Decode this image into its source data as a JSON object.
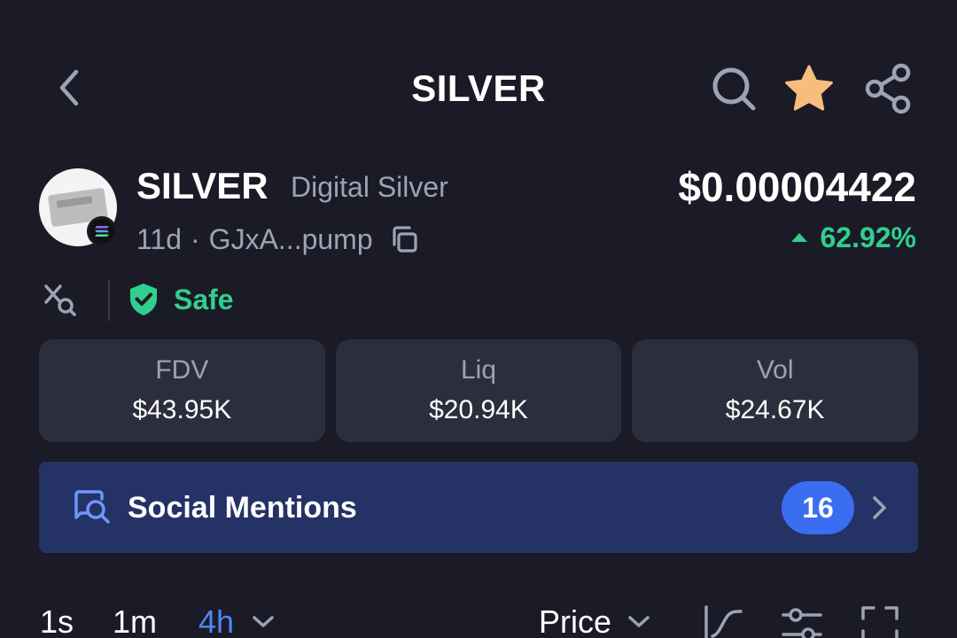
{
  "header": {
    "title": "SILVER"
  },
  "token": {
    "symbol": "SILVER",
    "name": "Digital Silver",
    "age": "11d",
    "address": "GJxA...pump",
    "meta_separator": "·",
    "price": "$0.00004422",
    "change": "62.92%",
    "change_direction": "up",
    "favorited": true
  },
  "safety": {
    "label": "Safe"
  },
  "stats": [
    {
      "label": "FDV",
      "value": "$43.95K"
    },
    {
      "label": "Liq",
      "value": "$20.94K"
    },
    {
      "label": "Vol",
      "value": "$24.67K"
    }
  ],
  "social": {
    "label": "Social Mentions",
    "count": "16"
  },
  "toolbar": {
    "timeframes": [
      "1s",
      "1m",
      "4h"
    ],
    "selected_timeframe": "4h",
    "price_label": "Price"
  },
  "icons": {
    "back": "chevron-left-icon",
    "search": "search-icon",
    "favorite": "star-icon",
    "share": "share-icon",
    "copy": "copy-icon",
    "x_search": "x-search-icon",
    "safe": "shield-check-icon",
    "social": "chat-search-icon",
    "chart_type": "line-chart-icon",
    "settings": "sliders-icon",
    "fullscreen": "fullscreen-icon"
  },
  "colors": {
    "background": "#1a1b26",
    "card": "#2c2e3d",
    "social_bg": "#253265",
    "positive": "#2fcf8e",
    "accent_blue": "#3a6df0",
    "selected_timeframe": "#4f86f7",
    "star": "#f8bd7d",
    "muted_text": "#9ea3b3"
  }
}
